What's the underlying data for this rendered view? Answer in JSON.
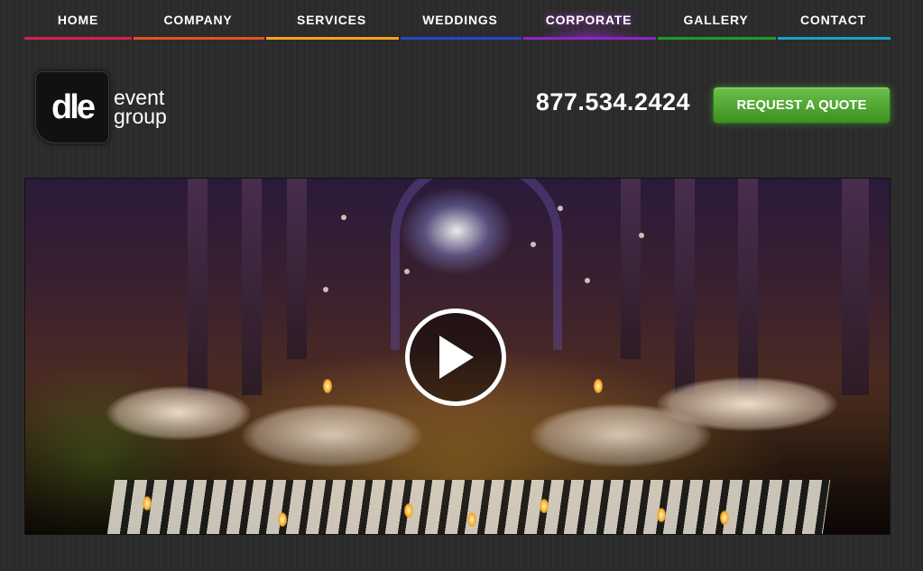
{
  "nav": {
    "items": [
      {
        "label": "HOME",
        "color": "#d81e4f"
      },
      {
        "label": "COMPANY",
        "color": "#e8511f"
      },
      {
        "label": "SERVICES",
        "color": "#f3a21c"
      },
      {
        "label": "WEDDINGS",
        "color": "#2247c9"
      },
      {
        "label": "CORPORATE",
        "color": "#8f23c4",
        "active": true
      },
      {
        "label": "GALLERY",
        "color": "#1f9b2a"
      },
      {
        "label": "CONTACT",
        "color": "#17a1c6"
      }
    ]
  },
  "header": {
    "logo_mark": "dle",
    "logo_line1": "event",
    "logo_line2": "group",
    "phone": "877.534.2424",
    "quote_button": "REQUEST A QUOTE",
    "quote_color": "#4fa82f"
  },
  "video": {
    "play_icon": "play-icon"
  }
}
